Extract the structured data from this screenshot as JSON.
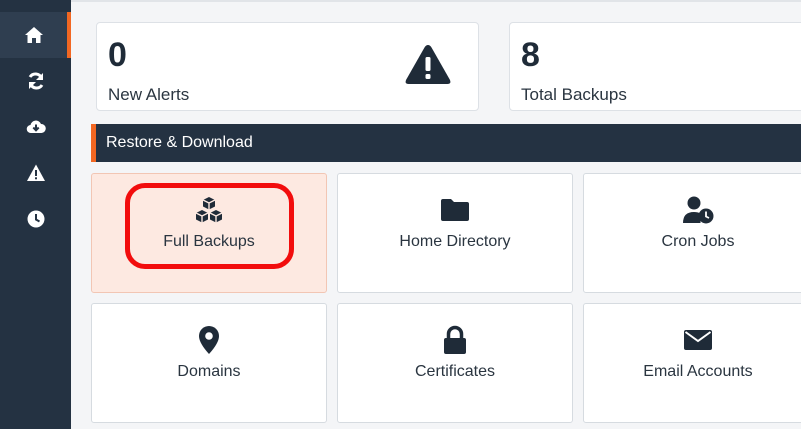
{
  "sidebar": {
    "items": [
      {
        "icon": "home-icon",
        "active": true
      },
      {
        "icon": "refresh-icon",
        "active": false
      },
      {
        "icon": "cloud-download-icon",
        "active": false
      },
      {
        "icon": "warning-icon",
        "active": false
      },
      {
        "icon": "clock-icon",
        "active": false
      }
    ]
  },
  "stats": [
    {
      "value": "0",
      "label": "New Alerts",
      "icon": "warning-triangle-icon"
    },
    {
      "value": "8",
      "label": "Total Backups"
    }
  ],
  "section": {
    "title": "Restore & Download"
  },
  "tiles": [
    {
      "label": "Full Backups",
      "icon": "cubes-icon",
      "selected": true
    },
    {
      "label": "Home Directory",
      "icon": "folder-icon",
      "selected": false
    },
    {
      "label": "Cron Jobs",
      "icon": "user-clock-icon",
      "selected": false
    },
    {
      "label": "Domains",
      "icon": "map-marker-icon",
      "selected": false
    },
    {
      "label": "Certificates",
      "icon": "lock-icon",
      "selected": false
    },
    {
      "label": "Email Accounts",
      "icon": "envelope-icon",
      "selected": false
    }
  ],
  "colors": {
    "sidebar_bg": "#243242",
    "accent": "#f26722",
    "highlight_ring": "#f20d0d",
    "selected_tile_bg": "#fde9e1"
  }
}
